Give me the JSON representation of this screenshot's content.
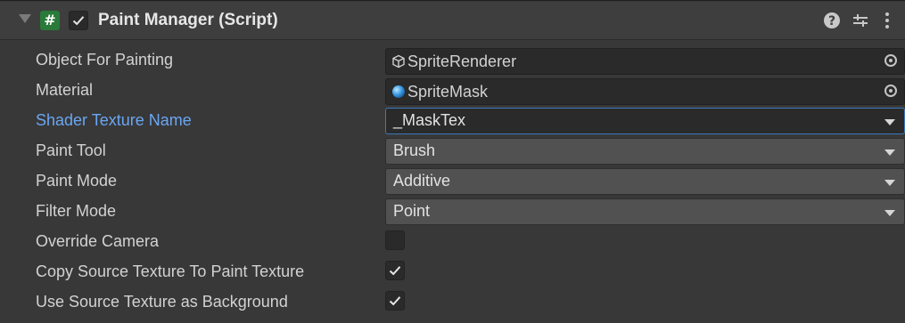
{
  "component": {
    "title": "Paint Manager (Script)",
    "script_icon_glyph": "#",
    "enabled": true,
    "header_icons": [
      "help-icon",
      "presets-icon",
      "more-options-icon"
    ]
  },
  "fields": {
    "object_for_painting": {
      "label": "Object For Painting",
      "value": "SpriteRenderer",
      "icon": "cube-icon"
    },
    "material": {
      "label": "Material",
      "value": "SpriteMask",
      "icon": "material-sphere-icon"
    },
    "shader_texture_name": {
      "label": "Shader Texture Name",
      "value": "_MaskTex"
    },
    "paint_tool": {
      "label": "Paint Tool",
      "value": "Brush"
    },
    "paint_mode": {
      "label": "Paint Mode",
      "value": "Additive"
    },
    "filter_mode": {
      "label": "Filter Mode",
      "value": "Point"
    },
    "override_camera": {
      "label": "Override Camera",
      "checked": false
    },
    "copy_source_texture": {
      "label": "Copy Source Texture To Paint Texture",
      "checked": true
    },
    "use_source_texture_bg": {
      "label": "Use Source Texture as Background",
      "checked": true
    }
  },
  "colors": {
    "background": "#383838",
    "header": "#3e3e3e",
    "highlight_label": "#6aa6f2",
    "focus_border": "#3a79bb",
    "script_icon": "#2a7a3a"
  }
}
